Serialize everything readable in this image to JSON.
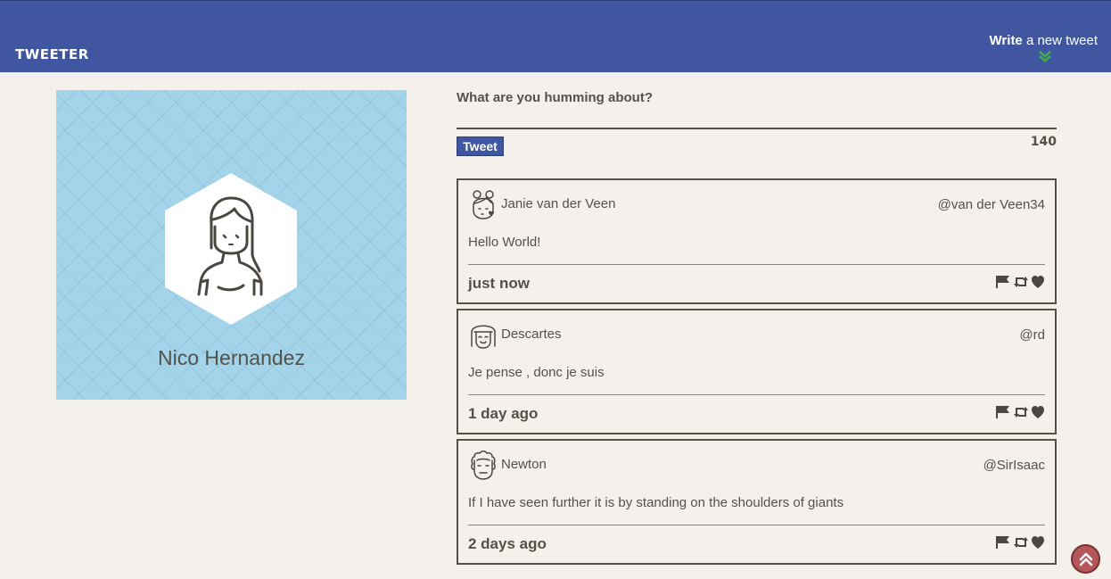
{
  "nav": {
    "brand": "TWEETER",
    "write_bold": "Write",
    "write_rest": " a new tweet"
  },
  "profile": {
    "name": "Nico Hernandez"
  },
  "composer": {
    "label": "What are you humming about?",
    "input_value": "",
    "tweet_button": "Tweet",
    "counter": "140"
  },
  "tweets": [
    {
      "name": "Janie van der Veen",
      "handle": "@van der Veen34",
      "content": "Hello World!",
      "time": "just now",
      "avatar_icon": "girl-buns-avatar-icon"
    },
    {
      "name": "Descartes",
      "handle": "@rd",
      "content": "Je pense , donc je suis",
      "time": "1 day ago",
      "avatar_icon": "bob-hair-avatar-icon"
    },
    {
      "name": "Newton",
      "handle": "@SirIsaac",
      "content": "If I have seen further it is by standing on the shoulders of giants",
      "time": "2 days ago",
      "avatar_icon": "curly-hair-avatar-icon"
    }
  ],
  "colors": {
    "nav_bg": "#4056a1",
    "page_bg": "#f4f1ec",
    "text": "#545149",
    "profile_bg": "#a3d4ea",
    "scroll_button": "#b5575a",
    "chevron_accent": "#3fae49"
  }
}
